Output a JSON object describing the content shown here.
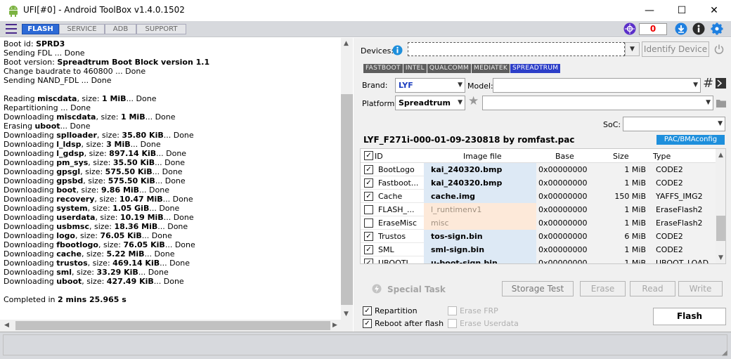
{
  "window": {
    "title": "UFI[#0] - Android ToolBox v1.4.0.1502",
    "controls": {
      "minimize": "—",
      "maximize": "☐",
      "close": "✕"
    }
  },
  "toolbar": {
    "tabs": [
      {
        "label": "FLASH",
        "active": true
      },
      {
        "label": "SERVICE",
        "active": false
      },
      {
        "label": "ADB",
        "active": false
      },
      {
        "label": "SUPPORT",
        "active": false
      }
    ],
    "counter": "0",
    "colors": {
      "accent": "#2d6ad6",
      "counter": "#e00000"
    }
  },
  "log": {
    "lines": [
      [
        [
          "Boot id: ",
          false
        ],
        [
          "SPRD3",
          true
        ]
      ],
      [
        [
          "Sending FDL ... Done",
          false
        ]
      ],
      [
        [
          "Boot version: ",
          false
        ],
        [
          "Spreadtrum Boot Block version 1.1",
          true
        ]
      ],
      [
        [
          "Change baudrate to 460800 ... Done",
          false
        ]
      ],
      [
        [
          "Sending NAND_FDL ... Done",
          false
        ]
      ],
      [],
      [
        [
          "Reading ",
          false
        ],
        [
          "miscdata",
          true
        ],
        [
          ", size: ",
          false
        ],
        [
          "1 MiB",
          true
        ],
        [
          "... Done",
          false
        ]
      ],
      [
        [
          "Repartitioning ... Done",
          false
        ]
      ],
      [
        [
          "Downloading ",
          false
        ],
        [
          "miscdata",
          true
        ],
        [
          ", size: ",
          false
        ],
        [
          "1 MiB",
          true
        ],
        [
          "... Done",
          false
        ]
      ],
      [
        [
          "Erasing ",
          false
        ],
        [
          "uboot",
          true
        ],
        [
          "... Done",
          false
        ]
      ],
      [
        [
          "Downloading ",
          false
        ],
        [
          "splloader",
          true
        ],
        [
          ", size: ",
          false
        ],
        [
          "35.80 KiB",
          true
        ],
        [
          "... Done",
          false
        ]
      ],
      [
        [
          "Downloading ",
          false
        ],
        [
          "l_ldsp",
          true
        ],
        [
          ", size: ",
          false
        ],
        [
          "3 MiB",
          true
        ],
        [
          "... Done",
          false
        ]
      ],
      [
        [
          "Downloading ",
          false
        ],
        [
          "l_gdsp",
          true
        ],
        [
          ", size: ",
          false
        ],
        [
          "897.14 KiB",
          true
        ],
        [
          "... Done",
          false
        ]
      ],
      [
        [
          "Downloading ",
          false
        ],
        [
          "pm_sys",
          true
        ],
        [
          ", size: ",
          false
        ],
        [
          "35.50 KiB",
          true
        ],
        [
          "... Done",
          false
        ]
      ],
      [
        [
          "Downloading ",
          false
        ],
        [
          "gpsgl",
          true
        ],
        [
          ", size: ",
          false
        ],
        [
          "575.50 KiB",
          true
        ],
        [
          "... Done",
          false
        ]
      ],
      [
        [
          "Downloading ",
          false
        ],
        [
          "gpsbd",
          true
        ],
        [
          ", size: ",
          false
        ],
        [
          "575.50 KiB",
          true
        ],
        [
          "... Done",
          false
        ]
      ],
      [
        [
          "Downloading ",
          false
        ],
        [
          "boot",
          true
        ],
        [
          ", size: ",
          false
        ],
        [
          "9.86 MiB",
          true
        ],
        [
          "... Done",
          false
        ]
      ],
      [
        [
          "Downloading ",
          false
        ],
        [
          "recovery",
          true
        ],
        [
          ", size: ",
          false
        ],
        [
          "10.47 MiB",
          true
        ],
        [
          "... Done",
          false
        ]
      ],
      [
        [
          "Downloading ",
          false
        ],
        [
          "system",
          true
        ],
        [
          ", size: ",
          false
        ],
        [
          "1.05 GiB",
          true
        ],
        [
          "... Done",
          false
        ]
      ],
      [
        [
          "Downloading ",
          false
        ],
        [
          "userdata",
          true
        ],
        [
          ", size: ",
          false
        ],
        [
          "10.19 MiB",
          true
        ],
        [
          "... Done",
          false
        ]
      ],
      [
        [
          "Downloading ",
          false
        ],
        [
          "usbmsc",
          true
        ],
        [
          ", size: ",
          false
        ],
        [
          "18.36 MiB",
          true
        ],
        [
          "... Done",
          false
        ]
      ],
      [
        [
          "Downloading ",
          false
        ],
        [
          "logo",
          true
        ],
        [
          ", size: ",
          false
        ],
        [
          "76.05 KiB",
          true
        ],
        [
          "... Done",
          false
        ]
      ],
      [
        [
          "Downloading ",
          false
        ],
        [
          "fbootlogo",
          true
        ],
        [
          ", size: ",
          false
        ],
        [
          "76.05 KiB",
          true
        ],
        [
          "... Done",
          false
        ]
      ],
      [
        [
          "Downloading ",
          false
        ],
        [
          "cache",
          true
        ],
        [
          ", size: ",
          false
        ],
        [
          "5.22 MiB",
          true
        ],
        [
          "... Done",
          false
        ]
      ],
      [
        [
          "Downloading ",
          false
        ],
        [
          "trustos",
          true
        ],
        [
          ", size: ",
          false
        ],
        [
          "469.14 KiB",
          true
        ],
        [
          "... Done",
          false
        ]
      ],
      [
        [
          "Downloading ",
          false
        ],
        [
          "sml",
          true
        ],
        [
          ", size: ",
          false
        ],
        [
          "33.29 KiB",
          true
        ],
        [
          "... Done",
          false
        ]
      ],
      [
        [
          "Downloading ",
          false
        ],
        [
          "uboot",
          true
        ],
        [
          ", size: ",
          false
        ],
        [
          "427.49 KiB",
          true
        ],
        [
          "... Done",
          false
        ]
      ],
      [],
      [
        [
          "Completed in ",
          false
        ],
        [
          "2 mins 25.965 s",
          true
        ]
      ]
    ]
  },
  "devices": {
    "label": "Devices:",
    "value": "",
    "identify_label": "Identify Device"
  },
  "vendor_tabs": [
    {
      "label": "FASTBOOT",
      "active": false
    },
    {
      "label": "INTEL",
      "active": false
    },
    {
      "label": "QUALCOMM",
      "active": false
    },
    {
      "label": "MEDIATEK",
      "active": false
    },
    {
      "label": "SPREADTRUM",
      "active": true
    }
  ],
  "brand": {
    "label": "Brand:",
    "value": "LYF"
  },
  "model": {
    "label": "Model:",
    "value": ""
  },
  "platform": {
    "label": "Platform:",
    "value": "Spreadtrum"
  },
  "soc": {
    "label": "SoC:",
    "value": ""
  },
  "pac": {
    "name": "LYF_F271i-000-01-09-230818 by romfast.pac",
    "button": "PAC/BMAconfig"
  },
  "table": {
    "headers": [
      "ID",
      "Image file",
      "Base",
      "Size",
      "Type"
    ],
    "rows": [
      {
        "checked": true,
        "id": "BootLogo",
        "file": "kai_240320.bmp",
        "base": "0x00000000",
        "size": "1 MiB",
        "type": "CODE2",
        "erase": false
      },
      {
        "checked": true,
        "id": "Fastboot...",
        "file": "kai_240320.bmp",
        "base": "0x00000000",
        "size": "1 MiB",
        "type": "CODE2",
        "erase": false
      },
      {
        "checked": true,
        "id": "Cache",
        "file": "cache.img",
        "base": "0x00000000",
        "size": "150 MiB",
        "type": "YAFFS_IMG2",
        "erase": false
      },
      {
        "checked": false,
        "id": "FLASH_...",
        "file": "l_runtimenv1",
        "base": "0x00000000",
        "size": "1 MiB",
        "type": "EraseFlash2",
        "erase": true
      },
      {
        "checked": false,
        "id": "EraseMisc",
        "file": "misc",
        "base": "0x00000000",
        "size": "1 MiB",
        "type": "EraseFlash2",
        "erase": true
      },
      {
        "checked": true,
        "id": "Trustos",
        "file": "tos-sign.bin",
        "base": "0x00000000",
        "size": "6 MiB",
        "type": "CODE2",
        "erase": false
      },
      {
        "checked": true,
        "id": "SML",
        "file": "sml-sign.bin",
        "base": "0x00000000",
        "size": "1 MiB",
        "type": "CODE2",
        "erase": false
      },
      {
        "checked": true,
        "id": "UBOOTL...",
        "file": "u-boot-sign.bin",
        "base": "0x00000000",
        "size": "1 MiB",
        "type": "UBOOT_LOAD...",
        "erase": false
      }
    ]
  },
  "actions": {
    "special_task": "Special Task",
    "storage_test": "Storage Test",
    "erase": "Erase",
    "read": "Read",
    "write": "Write",
    "flash": "Flash"
  },
  "options": {
    "repartition": {
      "label": "Repartition",
      "checked": true
    },
    "reboot": {
      "label": "Reboot after flash",
      "checked": true
    },
    "erase_frp": {
      "label": "Erase FRP",
      "checked": false
    },
    "erase_userdata": {
      "label": "Erase Userdata",
      "checked": false
    }
  }
}
